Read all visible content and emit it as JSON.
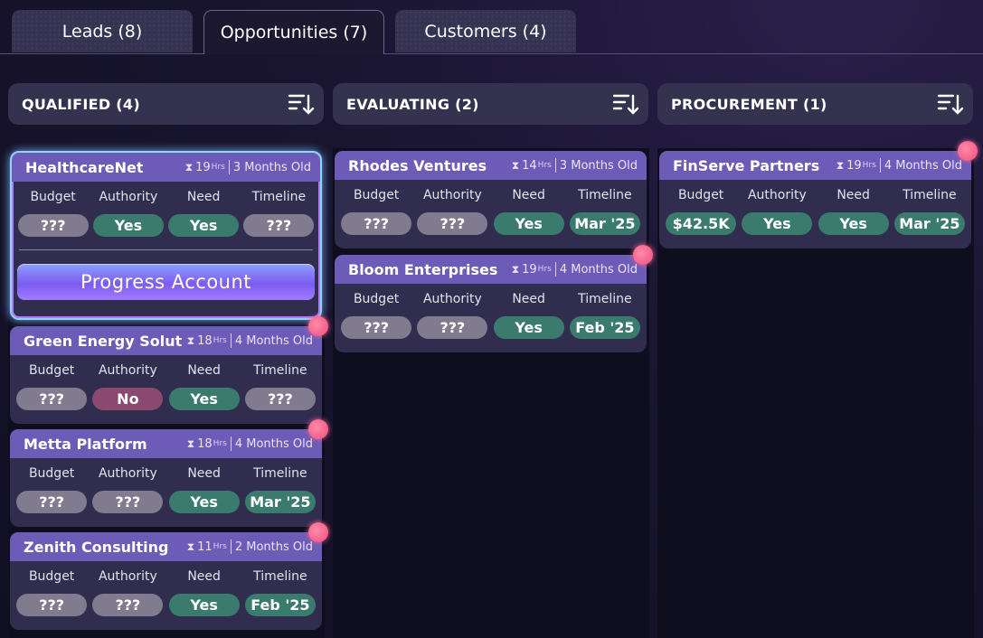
{
  "tabs": [
    {
      "label": "Leads (8)"
    },
    {
      "label": "Opportunities (7)"
    },
    {
      "label": "Customers (4)"
    }
  ],
  "columns": [
    {
      "title": "QUALIFIED (4)"
    },
    {
      "title": "EVALUATING (2)"
    },
    {
      "title": "PROCUREMENT (1)"
    }
  ],
  "field_labels": {
    "budget": "Budget",
    "authority": "Authority",
    "need": "Need",
    "timeline": "Timeline"
  },
  "hrs_unit": "Hrs",
  "progress_label": "Progress Account",
  "cards": [
    {
      "name": "HealthcareNet",
      "hours": "19",
      "age": "3 Months Old",
      "budget": "???",
      "authority": "Yes",
      "need": "Yes",
      "timeline": "???"
    },
    {
      "name": "Green Energy Soluti",
      "hours": "18",
      "age": "4 Months Old",
      "budget": "???",
      "authority": "No",
      "need": "Yes",
      "timeline": "???"
    },
    {
      "name": "Metta Platform",
      "hours": "18",
      "age": "4 Months Old",
      "budget": "???",
      "authority": "???",
      "need": "Yes",
      "timeline": "Mar '25"
    },
    {
      "name": "Zenith Consulting",
      "hours": "11",
      "age": "2 Months Old",
      "budget": "???",
      "authority": "???",
      "need": "Yes",
      "timeline": "Feb '25"
    },
    {
      "name": "Rhodes Ventures",
      "hours": "14",
      "age": "3 Months Old",
      "budget": "???",
      "authority": "???",
      "need": "Yes",
      "timeline": "Mar '25"
    },
    {
      "name": "Bloom Enterprises",
      "hours": "19",
      "age": "4 Months Old",
      "budget": "???",
      "authority": "???",
      "need": "Yes",
      "timeline": "Feb '25"
    },
    {
      "name": "FinServe Partners",
      "hours": "19",
      "age": "4 Months Old",
      "budget": "$42.5K",
      "authority": "Yes",
      "need": "Yes",
      "timeline": "Mar '25"
    }
  ]
}
